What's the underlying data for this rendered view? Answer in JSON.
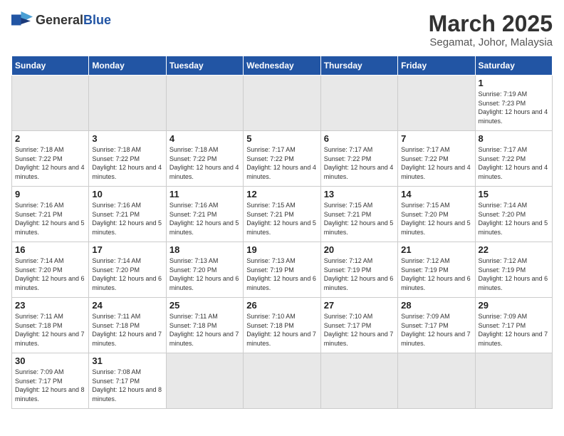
{
  "header": {
    "logo_general": "General",
    "logo_blue": "Blue",
    "month_title": "March 2025",
    "location": "Segamat, Johor, Malaysia"
  },
  "days_of_week": [
    "Sunday",
    "Monday",
    "Tuesday",
    "Wednesday",
    "Thursday",
    "Friday",
    "Saturday"
  ],
  "weeks": [
    [
      {
        "day": "",
        "empty": true
      },
      {
        "day": "",
        "empty": true
      },
      {
        "day": "",
        "empty": true
      },
      {
        "day": "",
        "empty": true
      },
      {
        "day": "",
        "empty": true
      },
      {
        "day": "",
        "empty": true
      },
      {
        "day": "1",
        "sunrise": "7:19 AM",
        "sunset": "7:23 PM",
        "daylight": "12 hours and 4 minutes."
      }
    ],
    [
      {
        "day": "2",
        "sunrise": "7:18 AM",
        "sunset": "7:22 PM",
        "daylight": "12 hours and 4 minutes."
      },
      {
        "day": "3",
        "sunrise": "7:18 AM",
        "sunset": "7:22 PM",
        "daylight": "12 hours and 4 minutes."
      },
      {
        "day": "4",
        "sunrise": "7:18 AM",
        "sunset": "7:22 PM",
        "daylight": "12 hours and 4 minutes."
      },
      {
        "day": "5",
        "sunrise": "7:17 AM",
        "sunset": "7:22 PM",
        "daylight": "12 hours and 4 minutes."
      },
      {
        "day": "6",
        "sunrise": "7:17 AM",
        "sunset": "7:22 PM",
        "daylight": "12 hours and 4 minutes."
      },
      {
        "day": "7",
        "sunrise": "7:17 AM",
        "sunset": "7:22 PM",
        "daylight": "12 hours and 4 minutes."
      },
      {
        "day": "8",
        "sunrise": "7:17 AM",
        "sunset": "7:22 PM",
        "daylight": "12 hours and 4 minutes."
      }
    ],
    [
      {
        "day": "9",
        "sunrise": "7:16 AM",
        "sunset": "7:21 PM",
        "daylight": "12 hours and 5 minutes."
      },
      {
        "day": "10",
        "sunrise": "7:16 AM",
        "sunset": "7:21 PM",
        "daylight": "12 hours and 5 minutes."
      },
      {
        "day": "11",
        "sunrise": "7:16 AM",
        "sunset": "7:21 PM",
        "daylight": "12 hours and 5 minutes."
      },
      {
        "day": "12",
        "sunrise": "7:15 AM",
        "sunset": "7:21 PM",
        "daylight": "12 hours and 5 minutes."
      },
      {
        "day": "13",
        "sunrise": "7:15 AM",
        "sunset": "7:21 PM",
        "daylight": "12 hours and 5 minutes."
      },
      {
        "day": "14",
        "sunrise": "7:15 AM",
        "sunset": "7:20 PM",
        "daylight": "12 hours and 5 minutes."
      },
      {
        "day": "15",
        "sunrise": "7:14 AM",
        "sunset": "7:20 PM",
        "daylight": "12 hours and 5 minutes."
      }
    ],
    [
      {
        "day": "16",
        "sunrise": "7:14 AM",
        "sunset": "7:20 PM",
        "daylight": "12 hours and 6 minutes."
      },
      {
        "day": "17",
        "sunrise": "7:14 AM",
        "sunset": "7:20 PM",
        "daylight": "12 hours and 6 minutes."
      },
      {
        "day": "18",
        "sunrise": "7:13 AM",
        "sunset": "7:20 PM",
        "daylight": "12 hours and 6 minutes."
      },
      {
        "day": "19",
        "sunrise": "7:13 AM",
        "sunset": "7:19 PM",
        "daylight": "12 hours and 6 minutes."
      },
      {
        "day": "20",
        "sunrise": "7:12 AM",
        "sunset": "7:19 PM",
        "daylight": "12 hours and 6 minutes."
      },
      {
        "day": "21",
        "sunrise": "7:12 AM",
        "sunset": "7:19 PM",
        "daylight": "12 hours and 6 minutes."
      },
      {
        "day": "22",
        "sunrise": "7:12 AM",
        "sunset": "7:19 PM",
        "daylight": "12 hours and 6 minutes."
      }
    ],
    [
      {
        "day": "23",
        "sunrise": "7:11 AM",
        "sunset": "7:18 PM",
        "daylight": "12 hours and 7 minutes."
      },
      {
        "day": "24",
        "sunrise": "7:11 AM",
        "sunset": "7:18 PM",
        "daylight": "12 hours and 7 minutes."
      },
      {
        "day": "25",
        "sunrise": "7:11 AM",
        "sunset": "7:18 PM",
        "daylight": "12 hours and 7 minutes."
      },
      {
        "day": "26",
        "sunrise": "7:10 AM",
        "sunset": "7:18 PM",
        "daylight": "12 hours and 7 minutes."
      },
      {
        "day": "27",
        "sunrise": "7:10 AM",
        "sunset": "7:17 PM",
        "daylight": "12 hours and 7 minutes."
      },
      {
        "day": "28",
        "sunrise": "7:09 AM",
        "sunset": "7:17 PM",
        "daylight": "12 hours and 7 minutes."
      },
      {
        "day": "29",
        "sunrise": "7:09 AM",
        "sunset": "7:17 PM",
        "daylight": "12 hours and 7 minutes."
      }
    ],
    [
      {
        "day": "30",
        "sunrise": "7:09 AM",
        "sunset": "7:17 PM",
        "daylight": "12 hours and 8 minutes."
      },
      {
        "day": "31",
        "sunrise": "7:08 AM",
        "sunset": "7:17 PM",
        "daylight": "12 hours and 8 minutes."
      },
      {
        "day": "",
        "empty": true
      },
      {
        "day": "",
        "empty": true
      },
      {
        "day": "",
        "empty": true
      },
      {
        "day": "",
        "empty": true
      },
      {
        "day": "",
        "empty": true
      }
    ]
  ]
}
